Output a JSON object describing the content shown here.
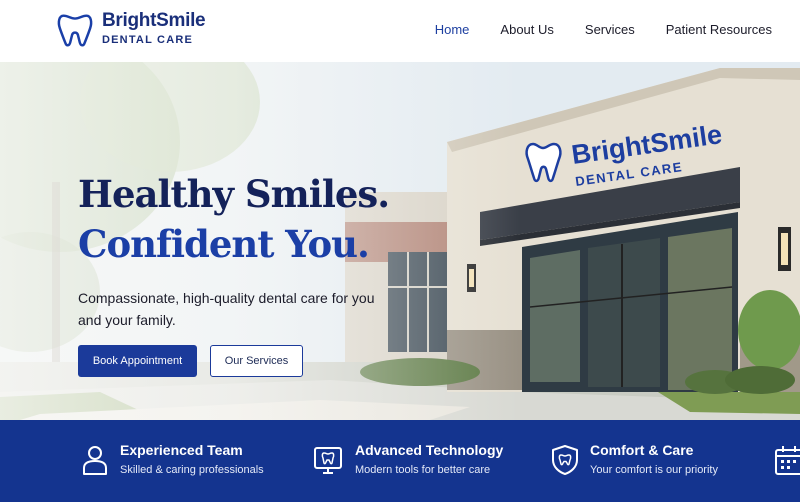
{
  "brand": {
    "name": "BrightSmile",
    "tagline": "DENTAL CARE",
    "color": "#1a2f7a"
  },
  "nav": {
    "items": [
      {
        "label": "Home",
        "active": true
      },
      {
        "label": "About Us",
        "active": false
      },
      {
        "label": "Services",
        "active": false
      },
      {
        "label": "Patient Resources",
        "active": false
      }
    ]
  },
  "hero": {
    "title_line1": "Healthy Smiles.",
    "title_line2": "Confident You.",
    "subtitle": "Compassionate, high-quality dental care for you and your family.",
    "primary_button": "Book Appointment",
    "secondary_button": "Our Services",
    "sign_name": "BrightSmile",
    "sign_sub": "DENTAL CARE"
  },
  "features": [
    {
      "icon": "person-icon",
      "title": "Experienced Team",
      "desc": "Skilled & caring professionals"
    },
    {
      "icon": "monitor-tooth-icon",
      "title": "Advanced Technology",
      "desc": "Modern tools for better care"
    },
    {
      "icon": "shield-tooth-icon",
      "title": "Comfort & Care",
      "desc": "Your comfort is our priority"
    },
    {
      "icon": "calendar-icon",
      "title": "",
      "desc": ""
    }
  ],
  "colors": {
    "primary": "#1b3a9a",
    "strip": "#14348f",
    "title_dark": "#14225a",
    "title_blue": "#1b3fa6"
  }
}
